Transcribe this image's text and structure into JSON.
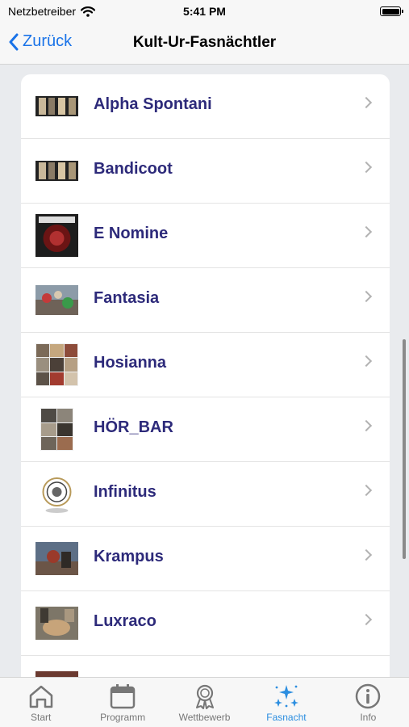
{
  "status": {
    "carrier": "Netzbetreiber",
    "time": "5:41 PM"
  },
  "nav": {
    "back_label": "Zurück",
    "title": "Kult-Ur-Fasnächtler"
  },
  "items": [
    {
      "label": "Alpha Spontani"
    },
    {
      "label": "Bandicoot"
    },
    {
      "label": "E Nomine"
    },
    {
      "label": "Fantasia"
    },
    {
      "label": "Hosianna"
    },
    {
      "label": "HÖR_BAR"
    },
    {
      "label": "Infinitus"
    },
    {
      "label": "Krampus"
    },
    {
      "label": "Luxraco"
    },
    {
      "label": ""
    }
  ],
  "tabs": [
    {
      "label": "Start",
      "icon": "home-icon"
    },
    {
      "label": "Programm",
      "icon": "calendar-icon"
    },
    {
      "label": "Wettbewerb",
      "icon": "award-icon"
    },
    {
      "label": "Fasnacht",
      "icon": "sparkles-icon"
    },
    {
      "label": "Info",
      "icon": "info-icon"
    }
  ],
  "colors": {
    "accent": "#2c8ee0",
    "item_text": "#2d2a7a",
    "back": "#1a73e8"
  }
}
